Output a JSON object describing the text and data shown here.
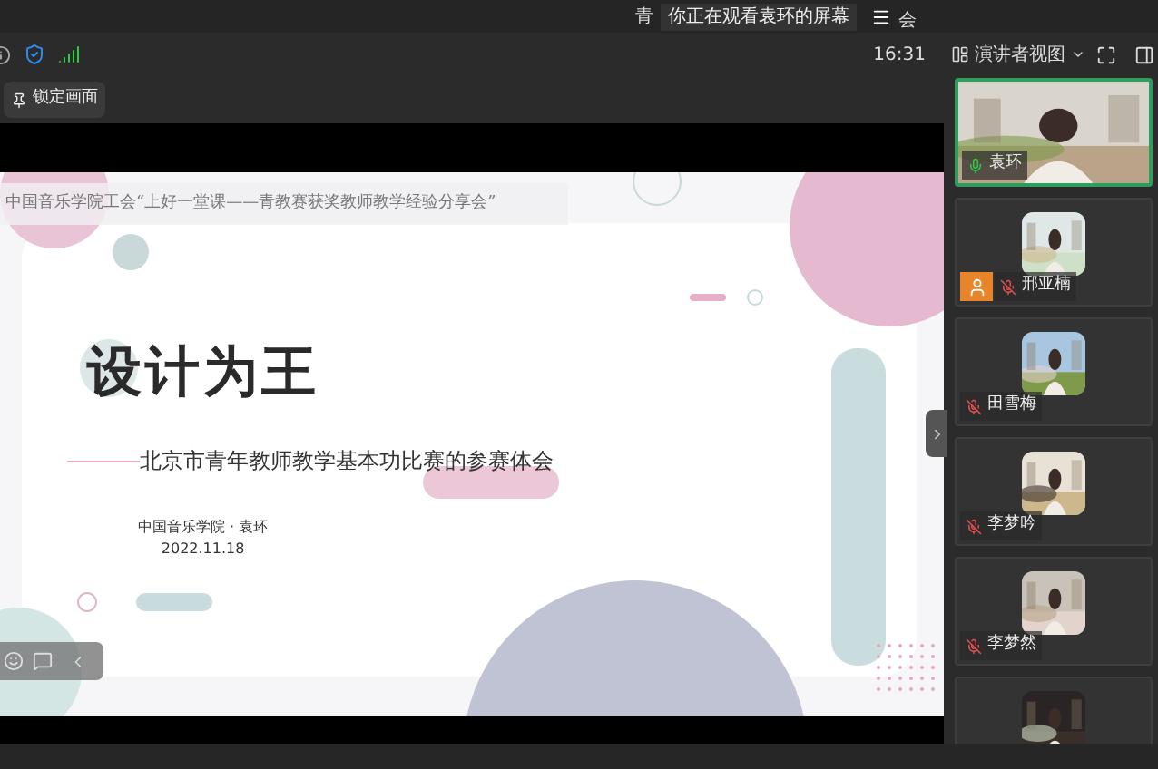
{
  "top_bar": {
    "partial_left": "青",
    "notice": "你正在观看袁环的屏幕",
    "partial_right": "会"
  },
  "toolbar": {
    "time": "16:31",
    "view_menu": "演讲者视图"
  },
  "lock_button": {
    "label": "锁定画面"
  },
  "slide": {
    "header": "中国音乐学院工会“上好一堂课——青教赛获奖教师教学经验分享会”",
    "title": "设计为王",
    "subtitle": "北京市青年教师教学基本功比赛的参赛体会",
    "author": "中国音乐学院 · 袁环",
    "date": "2022.11.18"
  },
  "participants": [
    {
      "name": "袁环",
      "kind": "video",
      "muted": false,
      "selected": true,
      "host": false
    },
    {
      "name": "邢亚楠",
      "kind": "avatar",
      "muted": true,
      "selected": false,
      "host": true
    },
    {
      "name": "田雪梅",
      "kind": "avatar",
      "muted": true,
      "selected": false,
      "host": false
    },
    {
      "name": "李梦吟",
      "kind": "avatar",
      "muted": true,
      "selected": false,
      "host": false
    },
    {
      "name": "李梦然",
      "kind": "avatar",
      "muted": true,
      "selected": false,
      "host": false
    },
    {
      "kind": "avatar",
      "selected": false,
      "host": false
    }
  ]
}
